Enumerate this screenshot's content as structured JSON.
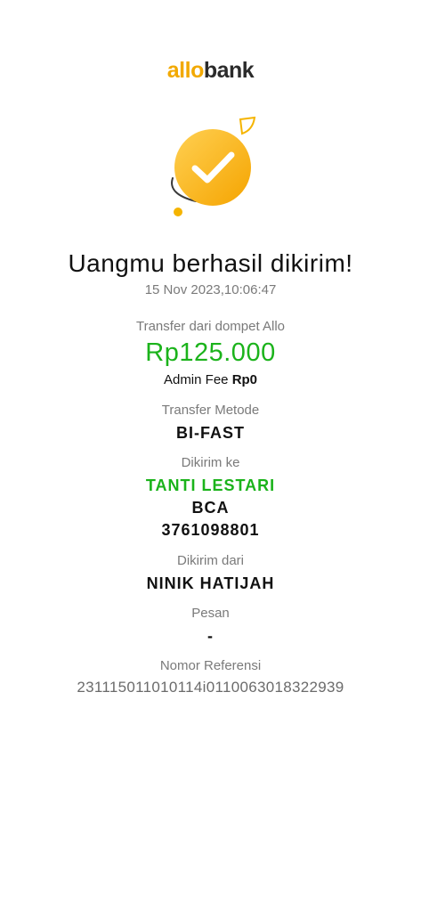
{
  "brand": {
    "part1": "allo",
    "part2": "bank"
  },
  "status": {
    "title": "Uangmu berhasil dikirim!",
    "datetime": "15 Nov 2023,10:06:47"
  },
  "transfer": {
    "source_label": "Transfer dari dompet Allo",
    "amount": "Rp125.000",
    "admin_fee_label": "Admin Fee",
    "admin_fee_value": "Rp0"
  },
  "method": {
    "label": "Transfer Metode",
    "value": "BI-FAST"
  },
  "recipient": {
    "label": "Dikirim ke",
    "name": "TANTI LESTARI",
    "bank": "BCA",
    "account": "3761098801"
  },
  "sender": {
    "label": "Dikirim dari",
    "name": "NINIK HATIJAH"
  },
  "message": {
    "label": "Pesan",
    "value": "-"
  },
  "reference": {
    "label": "Nomor Referensi",
    "value": "231115011010114i0110063018322939"
  },
  "colors": {
    "brand_yellow": "#f2a900",
    "success_green": "#1bb31b"
  },
  "icons": {
    "status": "success-check-icon"
  }
}
